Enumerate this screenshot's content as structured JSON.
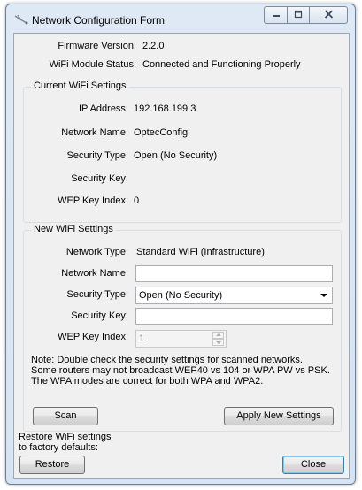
{
  "window": {
    "title": "Network Configuration Form",
    "icons": {
      "app": "network-tool-icon",
      "minimize": "minimize-icon",
      "maximize": "maximize-icon",
      "close": "close-icon"
    }
  },
  "info": {
    "firmware_label": "Firmware Version:",
    "firmware_value": "2.2.0",
    "status_label": "WiFi Module Status:",
    "status_value": "Connected and Functioning Properly"
  },
  "current": {
    "group_title": "Current WiFi Settings",
    "ip_label": "IP Address:",
    "ip_value": "192.168.199.3",
    "name_label": "Network Name:",
    "name_value": "OptecConfig",
    "security_label": "Security Type:",
    "security_value": "Open (No Security)",
    "key_label": "Security Key:",
    "key_value": "",
    "wep_label": "WEP Key Index:",
    "wep_value": "0"
  },
  "new_settings": {
    "group_title": "New WiFi Settings",
    "type_label": "Network Type:",
    "type_value": "Standard WiFi (Infrastructure)",
    "name_label": "Network Name:",
    "name_value": "",
    "security_label": "Security Type:",
    "security_value": "Open (No Security)",
    "key_label": "Security Key:",
    "key_value": "",
    "wep_label": "WEP Key Index:",
    "wep_value": "1",
    "note": "Note: Double check the security settings for scanned networks.\nSome routers may not broadcast WEP40 vs 104 or WPA PW vs PSK.\nThe WPA modes are correct for both WPA and WPA2.",
    "scan_button": "Scan",
    "apply_button": "Apply New Settings"
  },
  "footer": {
    "restore_text": "Restore WiFi settings\nto factory defaults:",
    "restore_button": "Restore",
    "close_button": "Close"
  }
}
